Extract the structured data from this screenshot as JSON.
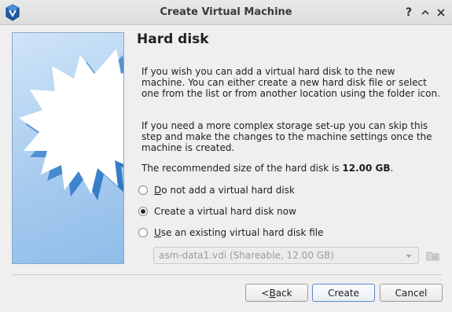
{
  "window": {
    "title": "Create Virtual Machine",
    "help_label": "?",
    "icons": [
      "virtualbox-app-icon",
      "help-icon",
      "collapse-icon",
      "close-icon"
    ]
  },
  "page": {
    "title": "Hard disk",
    "paragraph1": "If you wish you can add a virtual hard disk to the new machine. You can either create a new hard disk file or select one from the list or from another location using the folder icon.",
    "paragraph2": "If you need a more complex storage set-up you can skip this step and make the changes to the machine settings once the machine is created.",
    "recommended_prefix": "The recommended size of the hard disk is ",
    "recommended_size": "12.00 GB",
    "recommended_suffix": "."
  },
  "options": [
    {
      "mnemonic": "D",
      "rest": "o not add a virtual hard disk",
      "checked": false
    },
    {
      "mnemonic": "",
      "rest": "Create a virtual hard disk now",
      "checked": true
    },
    {
      "mnemonic": "U",
      "rest": "se an existing virtual hard disk file",
      "checked": false
    }
  ],
  "disk_select": {
    "value": "asm-data1.vdi (Shareable, 12.00 GB)",
    "enabled": false
  },
  "buttons": {
    "back_prefix": "< ",
    "back_mnemonic": "B",
    "back_rest": "ack",
    "create": "Create",
    "cancel": "Cancel"
  },
  "colors": {
    "accent": "#5a88c5",
    "image_blue": "#8fbde9",
    "star": "#ffffff"
  }
}
